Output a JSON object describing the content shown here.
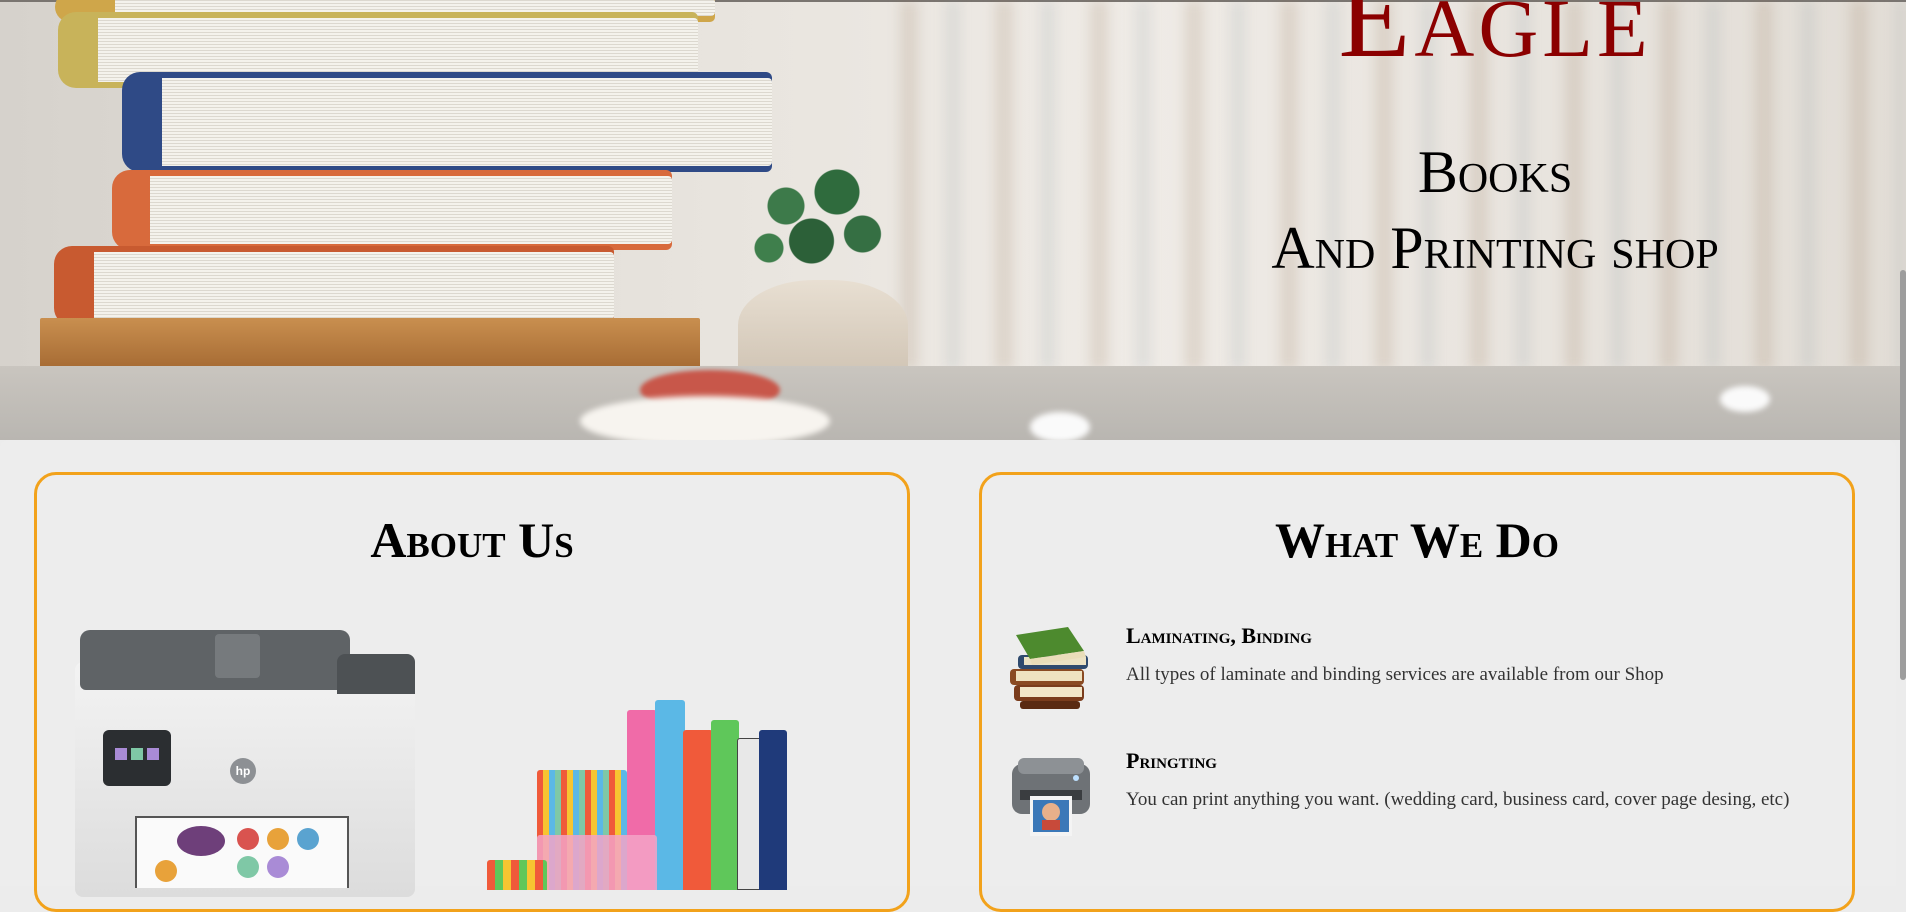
{
  "hero": {
    "brand": "Eagle",
    "tagline_line1": "Books",
    "tagline_line2": "And Printing shop"
  },
  "about": {
    "heading": "About Us",
    "printer_logo": "hp"
  },
  "what_we_do": {
    "heading": "What We Do",
    "services": [
      {
        "title": "Laminating, Binding",
        "description": "All types of laminate and binding services are available from our Shop",
        "icon": "stacked-books-icon"
      },
      {
        "title": "Pringting",
        "description": "You can print anything you want. (wedding card, business card, cover page desing, etc)",
        "icon": "photo-printer-icon"
      }
    ]
  },
  "colors": {
    "brand": "#8b0000",
    "card_border": "#f2a21b",
    "page_bg": "#ececec"
  }
}
